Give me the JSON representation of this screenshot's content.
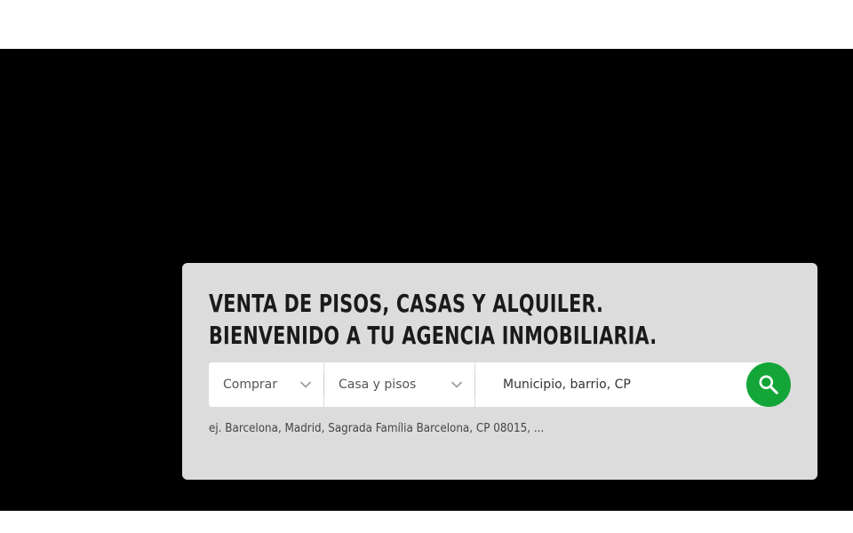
{
  "hero": {
    "headline_line1": "Venta de pisos, casas y alquiler.",
    "headline_line2": "Bienvenido a tu agencia inmobiliaria."
  },
  "search": {
    "operation_value": "Comprar",
    "type_value": "Casa y pisos",
    "location_placeholder": "Municipio, barrio, CP",
    "hint": "ej. Barcelona, Madrid, Sagrada Família Barcelona, CP 08015, ...",
    "button_icon": "search-icon",
    "accent_color": "#13a538"
  }
}
